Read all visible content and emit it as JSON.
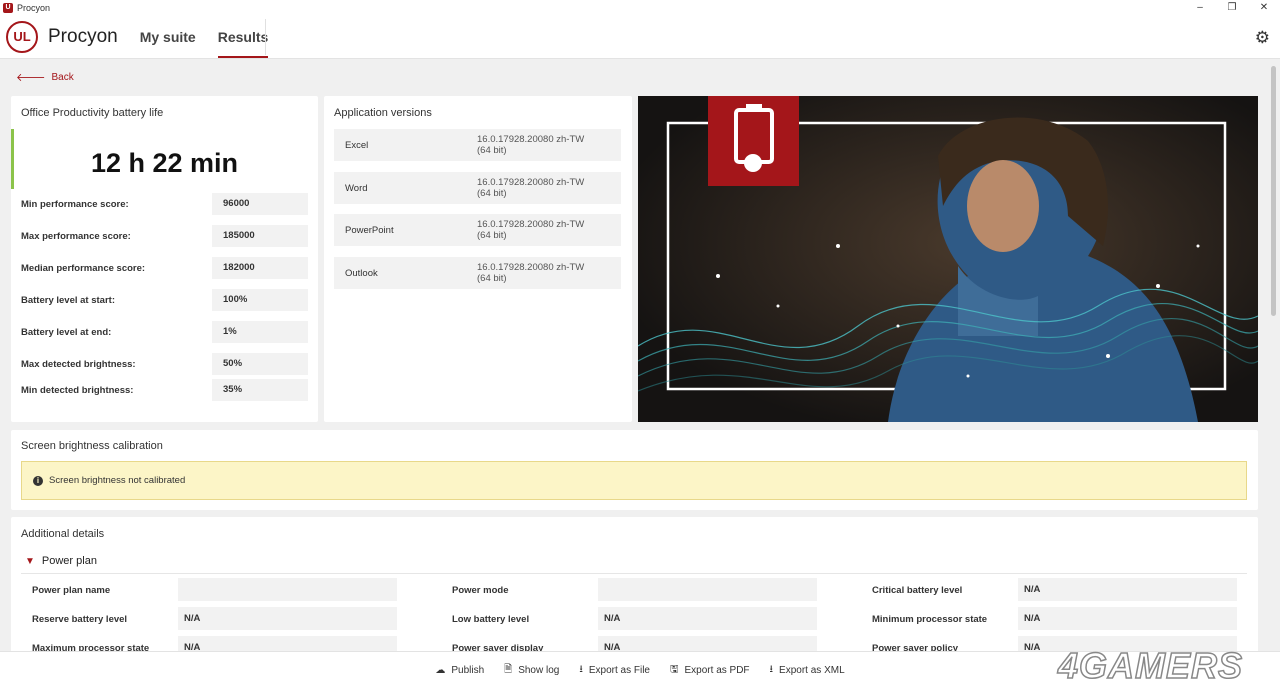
{
  "window": {
    "title": "Procyon",
    "app_icon_text": "U",
    "minimize": "–",
    "maximize": "❐",
    "close": "✕"
  },
  "header": {
    "logo_text": "UL",
    "brand": "Procyon",
    "tabs": [
      {
        "label": "My suite"
      },
      {
        "label": "Results"
      }
    ]
  },
  "back": {
    "label": "Back"
  },
  "battery": {
    "title": "Office Productivity battery life",
    "result": "12 h 22 min",
    "metrics": [
      {
        "label": "Min performance score:",
        "value": "96000"
      },
      {
        "label": "Max performance score:",
        "value": "185000"
      },
      {
        "label": "Median performance score:",
        "value": "182000"
      },
      {
        "label": "Battery level at start:",
        "value": "100%"
      },
      {
        "label": "Battery level at end:",
        "value": "1%"
      },
      {
        "label": "Max detected brightness:",
        "value": "50%"
      },
      {
        "label": "Min detected brightness:",
        "value": "35%"
      }
    ]
  },
  "versions": {
    "title": "Application versions",
    "apps": [
      {
        "name": "Excel",
        "v1": "16.0.17928.20080 zh-TW",
        "v2": "(64 bit)"
      },
      {
        "name": "Word",
        "v1": "16.0.17928.20080 zh-TW",
        "v2": "(64 bit)"
      },
      {
        "name": "PowerPoint",
        "v1": "16.0.17928.20080 zh-TW",
        "v2": "(64 bit)"
      },
      {
        "name": "Outlook",
        "v1": "16.0.17928.20080 zh-TW",
        "v2": "(64 bit)"
      }
    ]
  },
  "calibration": {
    "title": "Screen brightness calibration",
    "message": "Screen brightness not calibrated"
  },
  "details": {
    "title": "Additional details",
    "section": "Power plan",
    "rows": [
      [
        {
          "label": "Power plan name",
          "value": ""
        },
        {
          "label": "Power mode",
          "value": ""
        },
        {
          "label": "Critical battery level",
          "value": "N/A"
        }
      ],
      [
        {
          "label": "Reserve battery level",
          "value": "N/A"
        },
        {
          "label": "Low battery level",
          "value": "N/A"
        },
        {
          "label": "Minimum processor state",
          "value": "N/A"
        }
      ],
      [
        {
          "label": "Maximum processor state",
          "value": "N/A"
        },
        {
          "label": "Power saver display",
          "value": "N/A"
        },
        {
          "label": "Power saver policy",
          "value": "N/A"
        }
      ]
    ]
  },
  "footer": {
    "buttons": [
      {
        "label": "Publish",
        "icon": "cloud-upload-icon"
      },
      {
        "label": "Show log",
        "icon": "document-icon"
      },
      {
        "label": "Export as File",
        "icon": "download-icon"
      },
      {
        "label": "Export as PDF",
        "icon": "save-icon"
      },
      {
        "label": "Export as XML",
        "icon": "download-icon"
      }
    ]
  },
  "watermark": "4GAMERS",
  "colors": {
    "accent": "#a4161a",
    "success": "#8bc34a",
    "warning_bg": "#fcf5c7"
  }
}
